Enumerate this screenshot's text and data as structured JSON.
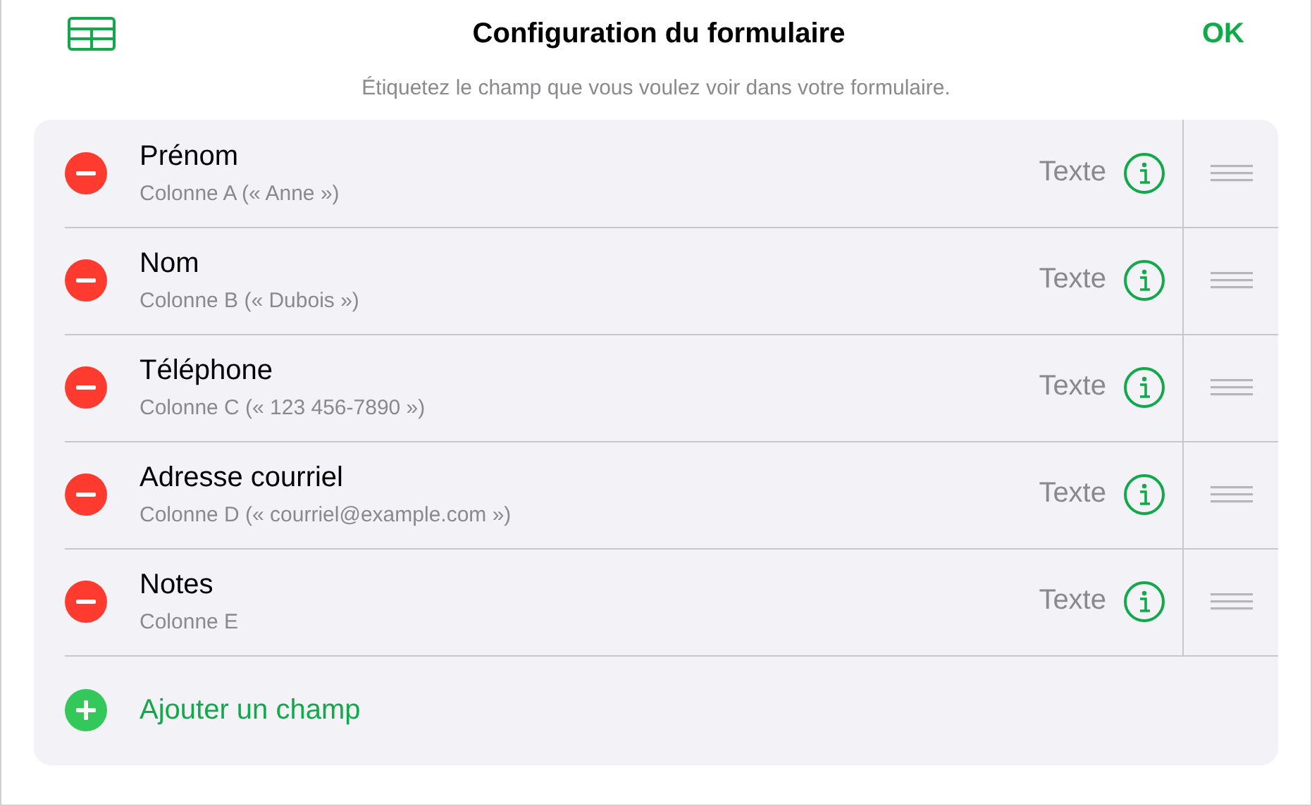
{
  "header": {
    "title": "Configuration du formulaire",
    "done_button": "OK",
    "subtitle": "Étiquetez le champ que vous voulez voir dans votre formulaire."
  },
  "fields": [
    {
      "label": "Prénom",
      "source": "Colonne A (« Anne »)",
      "type": "Texte"
    },
    {
      "label": "Nom",
      "source": "Colonne B (« Dubois »)",
      "type": "Texte"
    },
    {
      "label": "Téléphone",
      "source": "Colonne C (« 123 456-7890 »)",
      "type": "Texte"
    },
    {
      "label": "Adresse courriel",
      "source": "Colonne D (« courriel@example.com »)",
      "type": "Texte"
    },
    {
      "label": "Notes",
      "source": "Colonne E",
      "type": "Texte"
    }
  ],
  "add_field": "Ajouter un champ"
}
